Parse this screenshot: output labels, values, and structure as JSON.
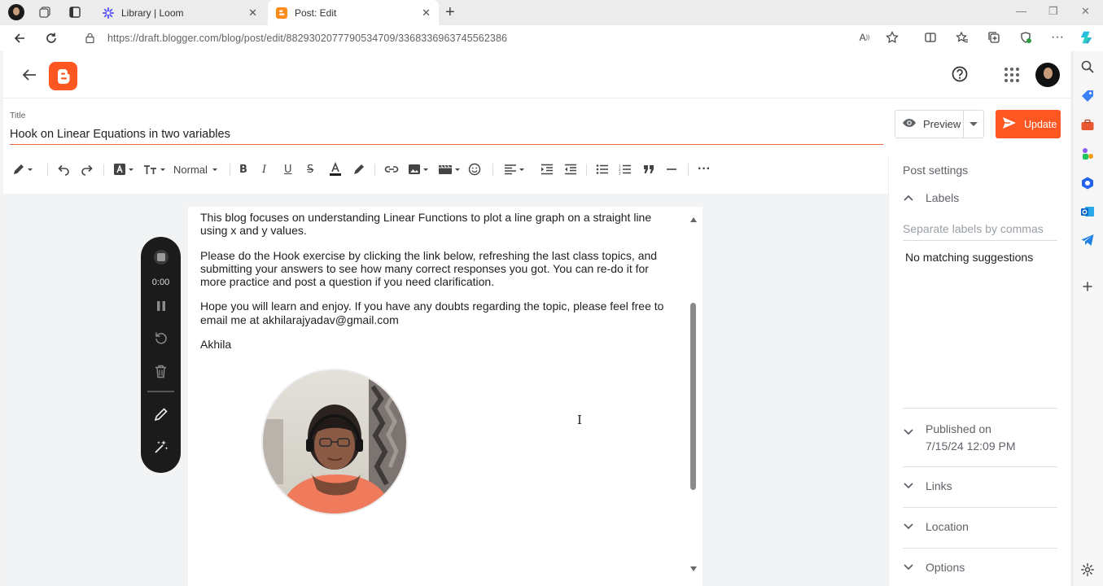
{
  "browser": {
    "tabs": [
      {
        "title": "Library | Loom",
        "active": false
      },
      {
        "title": "Post: Edit",
        "active": true
      }
    ],
    "url_host": "https://draft.blogger.com",
    "url_path": "/blog/post/edit/8829302077790534709/3368336963745562386"
  },
  "app": {
    "title_label": "Title",
    "title_value": "Hook on Linear Equations in two variables",
    "preview_label": "Preview",
    "update_label": "Update",
    "toolbar": {
      "paragraph_style": "Normal"
    }
  },
  "editor": {
    "paragraphs": [
      "This blog focuses on understanding Linear Functions to plot a line graph on a straight line using x and y values.",
      "Please do the Hook exercise by clicking the link below, refreshing the last class topics, and submitting your answers to see how many correct responses you got. You can re-do it for more practice and post a question if you need clarification.",
      "Hope you will learn and enjoy. If you have any doubts regarding the topic, please feel free to email me at akhilarajyadav@gmail.com",
      "Akhila"
    ]
  },
  "recorder": {
    "timer": "0:00"
  },
  "settings": {
    "heading": "Post settings",
    "labels_title": "Labels",
    "labels_placeholder": "Separate labels by commas",
    "labels_suggestions": "No matching suggestions",
    "published_title": "Published on",
    "published_date": "7/15/24 12:09 PM",
    "links_title": "Links",
    "location_title": "Location",
    "options_title": "Options"
  },
  "colors": {
    "brand_orange": "#ff5722",
    "recorder_bg": "#1b1b1b"
  }
}
